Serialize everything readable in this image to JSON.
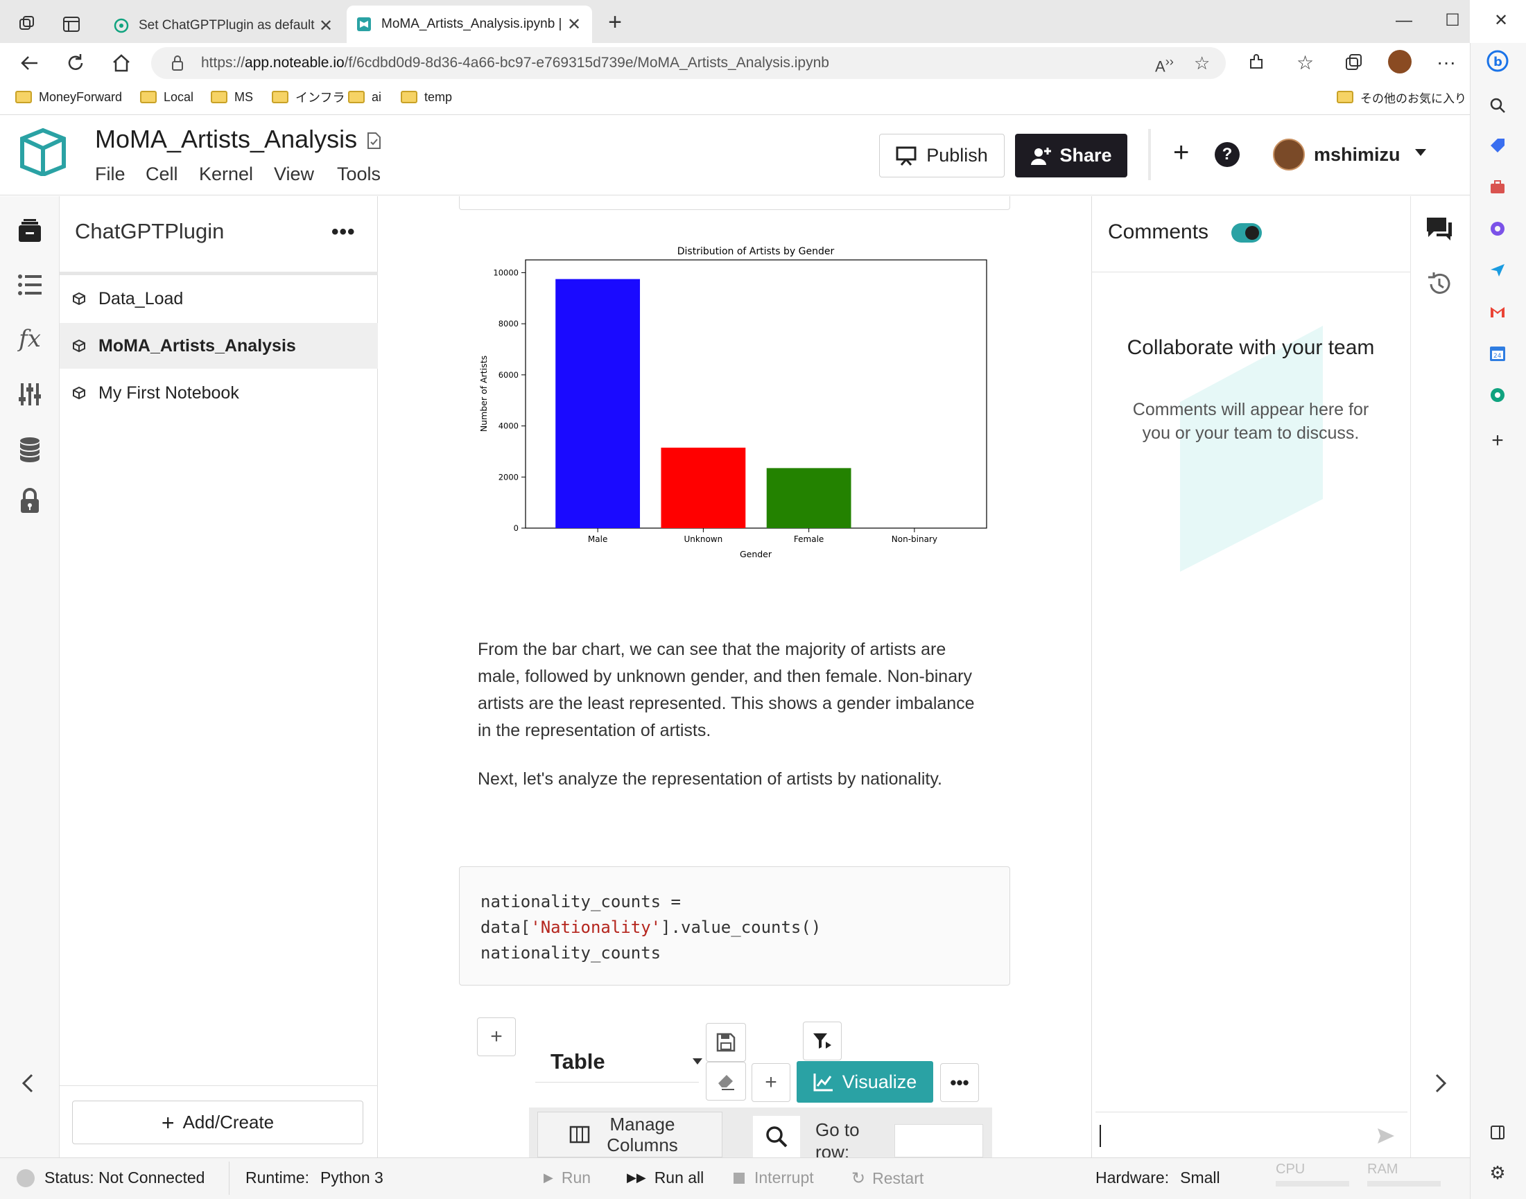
{
  "browser": {
    "tabs": [
      {
        "title": "Set ChatGPTPlugin as default",
        "active": false
      },
      {
        "title": "MoMA_Artists_Analysis.ipynb | N",
        "active": true
      }
    ],
    "url_prefix": "https://",
    "url_host": "app.noteable.io",
    "url_path": "/f/6cdbd0d9-8d36-4a66-bc97-e769315d739e/MoMA_Artists_Analysis.ipynb",
    "bookmarks": [
      "MoneyForward",
      "Local",
      "MS",
      "インフラ",
      "ai",
      "temp"
    ],
    "other_bookmarks": "その他のお気に入り"
  },
  "app": {
    "notebook_title": "MoMA_Artists_Analysis",
    "menu": [
      "File",
      "Cell",
      "Kernel",
      "View",
      "Tools"
    ],
    "publish_label": "Publish",
    "share_label": "Share",
    "username": "mshimizu",
    "accent_color": "#2aa2a4"
  },
  "sidebar": {
    "project_title": "ChatGPTPlugin",
    "more": "•••",
    "items": [
      {
        "label": "Data_Load",
        "active": false
      },
      {
        "label": "MoMA_Artists_Analysis",
        "active": true
      },
      {
        "label": "My First Notebook",
        "active": false
      }
    ],
    "add_create_label": "Add/Create"
  },
  "chart_data": {
    "type": "bar",
    "title": "Distribution of Artists by Gender",
    "xlabel": "Gender",
    "ylabel": "Number of Artists",
    "categories": [
      "Male",
      "Unknown",
      "Female",
      "Non-binary"
    ],
    "values": [
      9750,
      3150,
      2350,
      0
    ],
    "colors": [
      "#1a0aff",
      "#ff0000",
      "#238200",
      "#1a0aff"
    ],
    "ylim": [
      0,
      10500
    ],
    "yticks": [
      0,
      2000,
      4000,
      6000,
      8000,
      10000
    ],
    "grid": false
  },
  "notebook": {
    "markdown_1": "From the bar chart, we can see that the majority of artists are male, followed by unknown gender, and then female. Non-binary artists are the least represented. This shows a gender imbalance in the representation of artists.",
    "markdown_2": "Next, let's analyze the representation of artists by nationality.",
    "code_line1": "nationality_counts =",
    "code_line2_a": "data[",
    "code_line2_str": "'Nationality'",
    "code_line2_b": "].value_counts()",
    "code_line3": "nationality_counts",
    "output_mode": "Table",
    "visualize_label": "Visualize",
    "manage_columns_label": "Manage Columns",
    "goto_row_label": "Go to row:"
  },
  "comments": {
    "title": "Comments",
    "empty_title": "Collaborate with your team",
    "empty_desc": "Comments will appear here for you or your team to discuss."
  },
  "status": {
    "status_text": "Status: Not Connected",
    "runtime_label": "Runtime:",
    "runtime_value": "Python 3",
    "run": "Run",
    "run_all": "Run all",
    "interrupt": "Interrupt",
    "restart": "Restart",
    "hardware_label": "Hardware:",
    "hardware_value": "Small",
    "cpu": "CPU",
    "ram": "RAM"
  }
}
